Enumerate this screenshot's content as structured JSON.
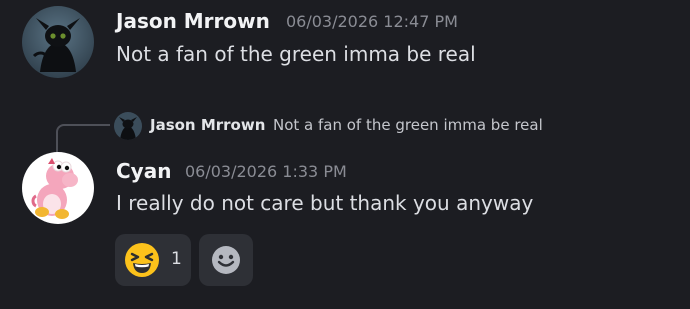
{
  "messages": [
    {
      "username": "Jason Mrrown",
      "timestamp": "06/03/2026 12:47 PM",
      "content": "Not a fan of the green imma be real",
      "avatar_icon": "dark-dragon-avatar-icon"
    },
    {
      "username": "Cyan",
      "timestamp": "06/03/2026 1:33 PM",
      "content": "I really do not care but thank you anyway",
      "avatar_icon": "pink-yoshi-plush-avatar-icon",
      "reply": {
        "username": "Jason Mrrown",
        "content": "Not a fan of the green imma be real"
      },
      "reactions": [
        {
          "emoji": "laughing-squinting-face-icon",
          "count": "1"
        }
      ],
      "add_reaction_icon": "add-reaction-smiley-icon"
    }
  ],
  "colors": {
    "background": "#1c1d22",
    "username": "#f2f3f5",
    "timestamp": "#8a8c94",
    "message_text": "#dcdee3",
    "reaction_bg": "#2e3036",
    "emoji_yellow": "#fcc21b"
  }
}
